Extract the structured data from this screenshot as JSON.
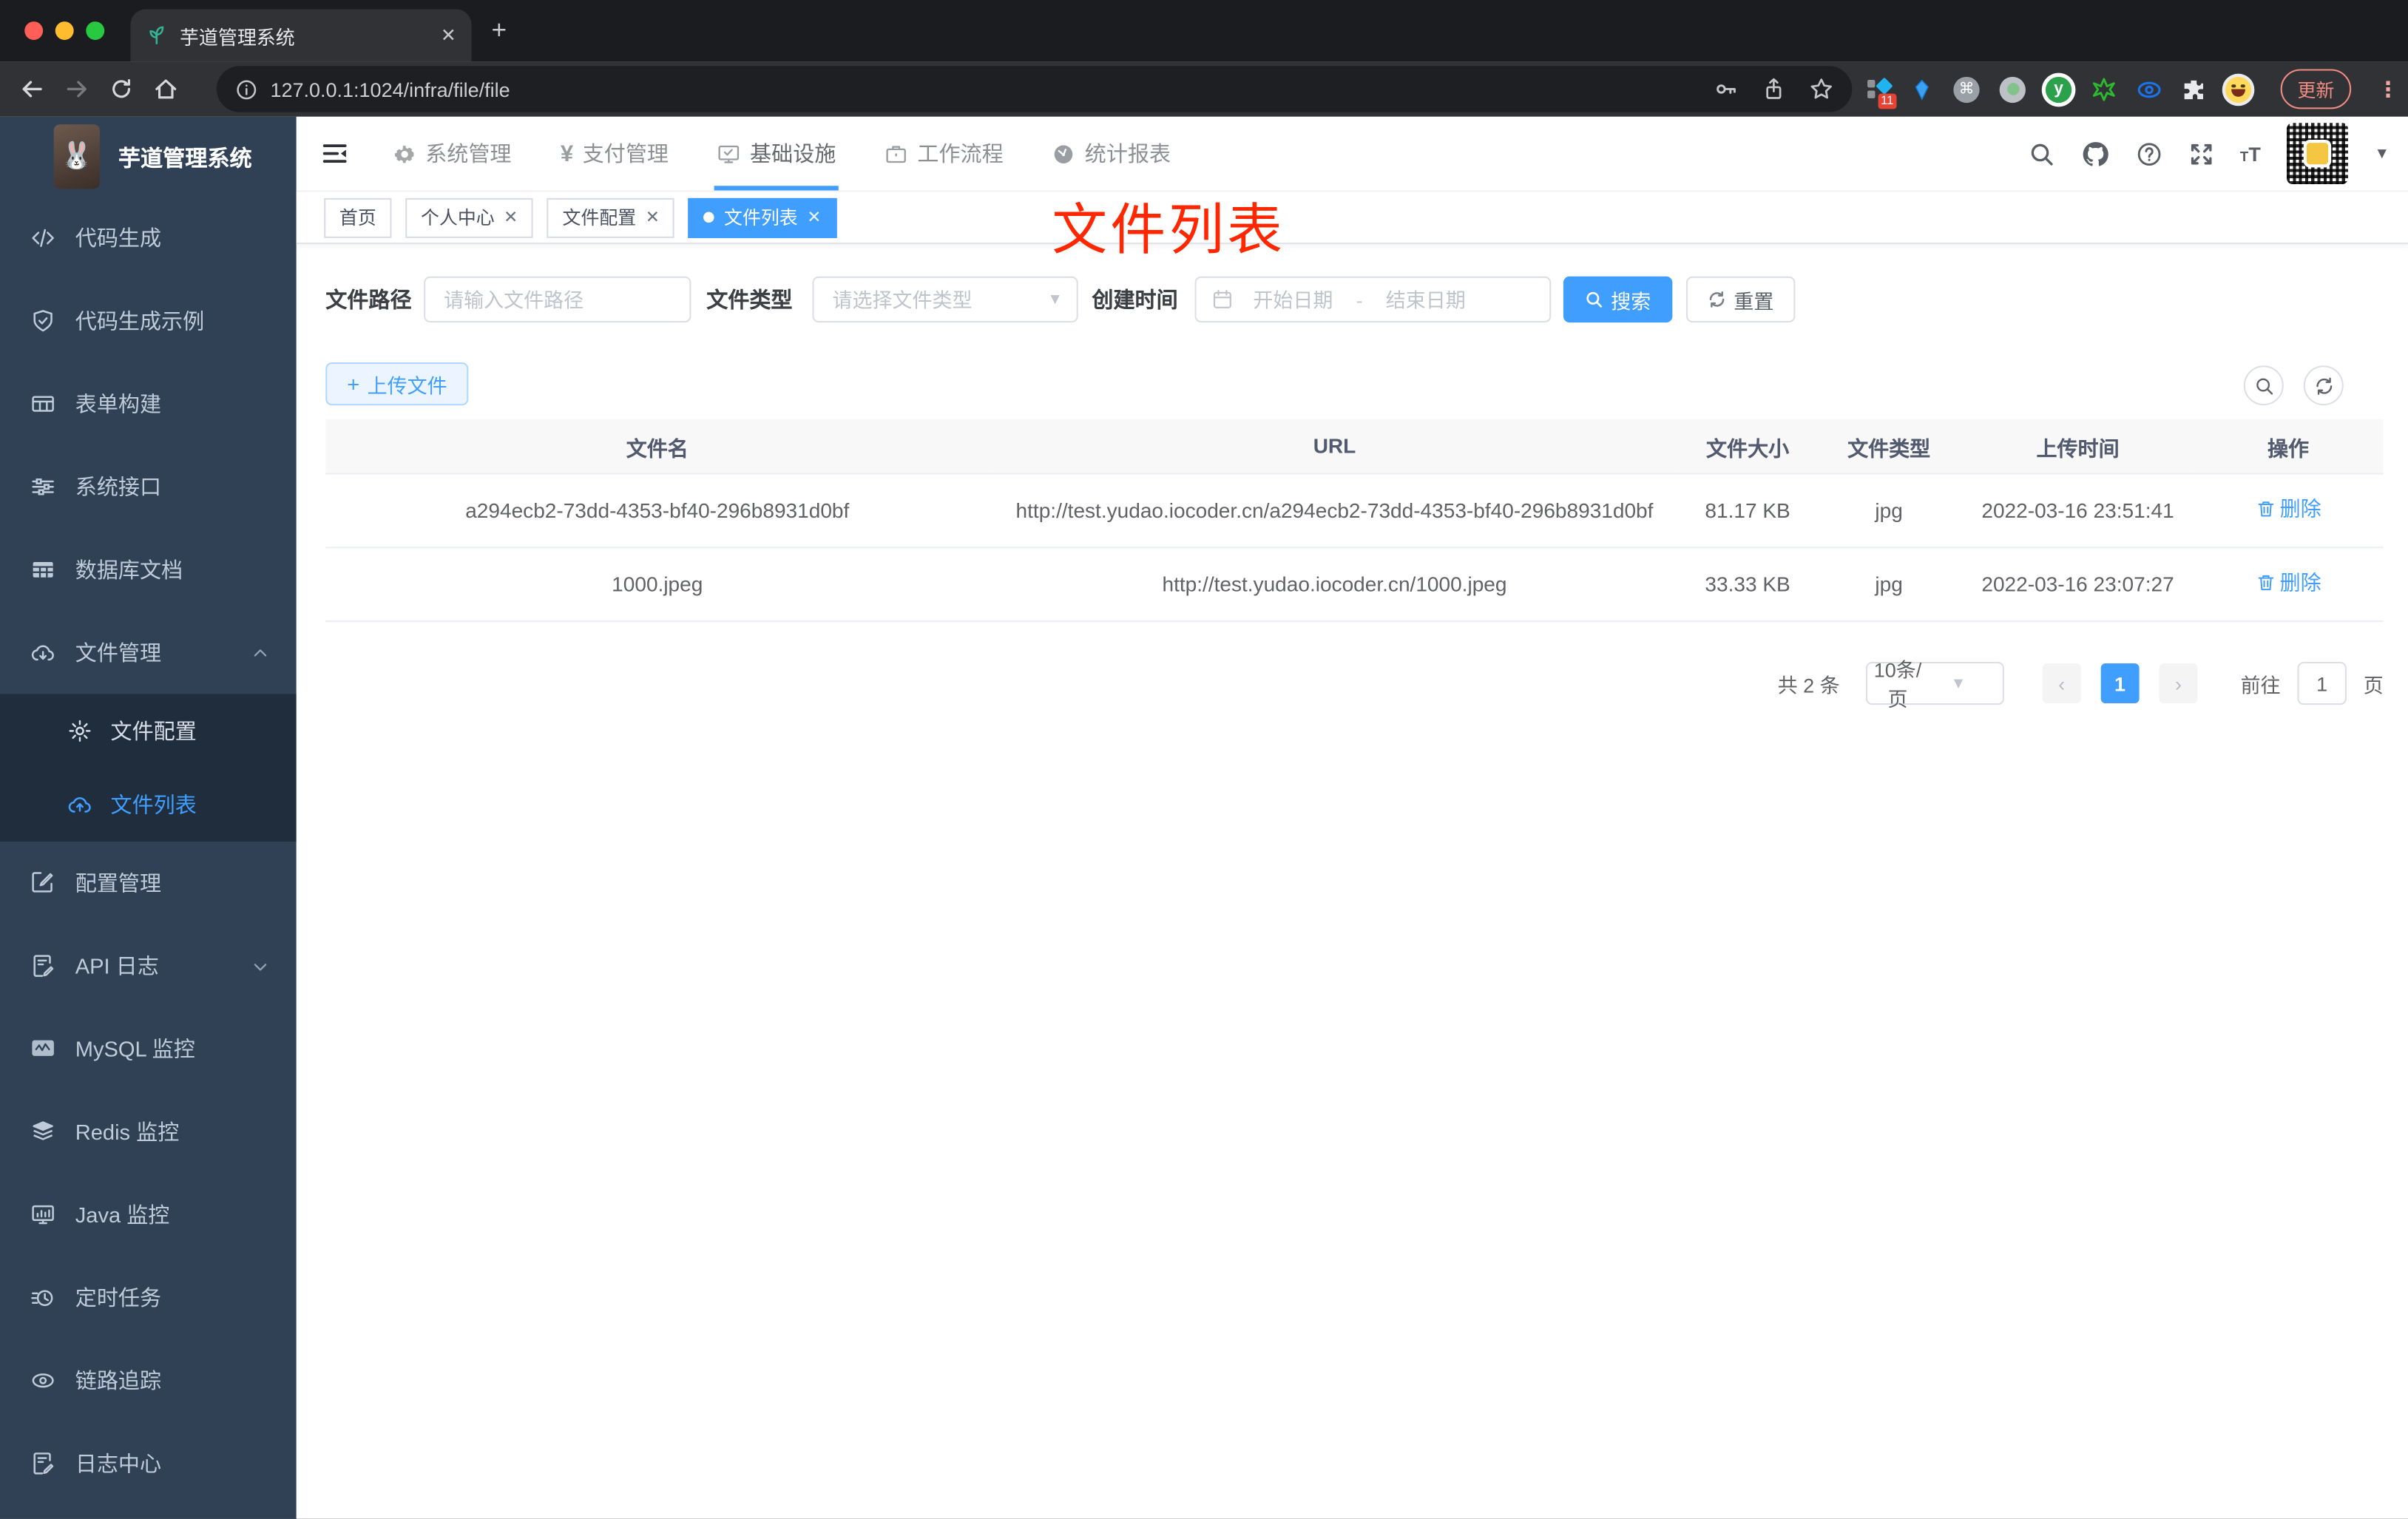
{
  "browser": {
    "tab_title": "芋道管理系统",
    "url": "127.0.0.1:1024/infra/file/file",
    "new_tab": "+",
    "extension_badge": "11",
    "update_label": "更新",
    "icons": [
      "back-icon",
      "forward-icon",
      "reload-icon",
      "home-icon",
      "info-icon",
      "key-icon",
      "share-icon",
      "star-icon",
      "extensions",
      "more-menu-icon"
    ]
  },
  "app": {
    "logo_title": "芋道管理系统",
    "topnav": {
      "items": [
        {
          "label": "系统管理",
          "icon": "gear-icon"
        },
        {
          "label": "支付管理",
          "icon": "yen-icon"
        },
        {
          "label": "基础设施",
          "icon": "infra-monitor-icon",
          "active": true
        },
        {
          "label": "工作流程",
          "icon": "briefcase-icon"
        },
        {
          "label": "统计报表",
          "icon": "dashboard-icon"
        }
      ]
    },
    "header_icons": [
      "search-icon",
      "github-icon",
      "help-icon",
      "fullscreen-icon",
      "font-size-icon",
      "qr-avatar",
      "caret-down-icon"
    ],
    "sidebar": {
      "items": [
        {
          "label": "代码生成",
          "icon": "code-icon"
        },
        {
          "label": "代码生成示例",
          "icon": "shield-check-icon"
        },
        {
          "label": "表单构建",
          "icon": "form-builder-icon"
        },
        {
          "label": "系统接口",
          "icon": "sliders-icon"
        },
        {
          "label": "数据库文档",
          "icon": "database-table-icon"
        },
        {
          "label": "文件管理",
          "icon": "cloud-download-icon",
          "expanded": true
        },
        {
          "label": "文件配置",
          "icon": "gear-icon",
          "submenu": true
        },
        {
          "label": "文件列表",
          "icon": "cloud-upload-icon",
          "submenu": true,
          "active": true
        },
        {
          "label": "配置管理",
          "icon": "edit-square-icon"
        },
        {
          "label": "API 日志",
          "icon": "document-edit-icon",
          "collapsed": true
        },
        {
          "label": "MySQL 监控",
          "icon": "chart-monitor-icon"
        },
        {
          "label": "Redis 监控",
          "icon": "layers-icon"
        },
        {
          "label": "Java 监控",
          "icon": "monitor-bars-icon"
        },
        {
          "label": "定时任务",
          "icon": "timer-icon"
        },
        {
          "label": "链路追踪",
          "icon": "eye-icon"
        },
        {
          "label": "日志中心",
          "icon": "log-edit-icon"
        }
      ]
    },
    "tags": [
      {
        "label": "首页",
        "closable": false
      },
      {
        "label": "个人中心",
        "closable": true
      },
      {
        "label": "文件配置",
        "closable": true
      },
      {
        "label": "文件列表",
        "closable": true,
        "active": true
      }
    ],
    "annotation": "文件列表",
    "filters": {
      "path_label": "文件路径",
      "path_placeholder": "请输入文件路径",
      "type_label": "文件类型",
      "type_placeholder": "请选择文件类型",
      "time_label": "创建时间",
      "start_placeholder": "开始日期",
      "range_separator": "-",
      "end_placeholder": "结束日期",
      "search_label": "搜索",
      "reset_label": "重置"
    },
    "actions": {
      "upload_label": "上传文件"
    },
    "table": {
      "headers": [
        "文件名",
        "URL",
        "文件大小",
        "文件类型",
        "上传时间",
        "操作"
      ],
      "rows": [
        {
          "name": "a294ecb2-73dd-4353-bf40-296b8931d0bf",
          "url": "http://test.yudao.iocoder.cn/a294ecb2-73dd-4353-bf40-296b8931d0bf",
          "size": "81.17 KB",
          "type": "jpg",
          "time": "2022-03-16 23:51:41",
          "action": "删除"
        },
        {
          "name": "1000.jpeg",
          "url": "http://test.yudao.iocoder.cn/1000.jpeg",
          "size": "33.33 KB",
          "type": "jpg",
          "time": "2022-03-16 23:07:27",
          "action": "删除"
        }
      ]
    },
    "pagination": {
      "total": "共 2 条",
      "page_size": "10条/页",
      "current_page": "1",
      "goto_label": "前往",
      "goto_value": "1",
      "page_unit": "页"
    }
  },
  "colors": {
    "primary": "#409eff",
    "sidebar_bg": "#304156",
    "submenu_bg": "#1f2d3d",
    "annotation_red": "#ff2600"
  }
}
